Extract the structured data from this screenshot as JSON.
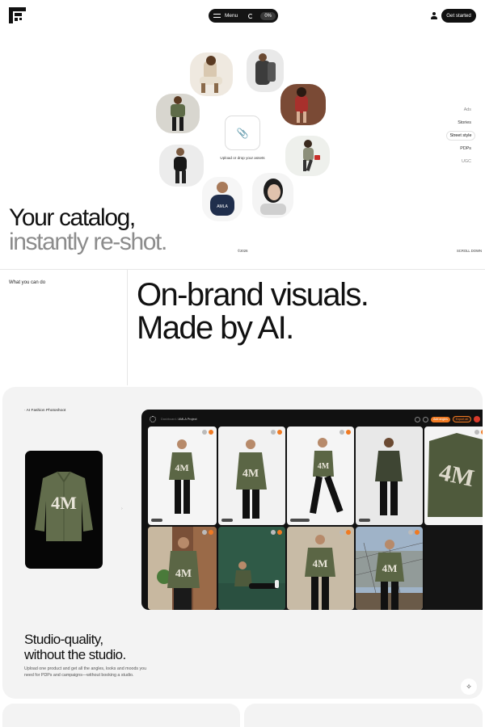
{
  "header": {
    "menu_label": "Menu",
    "progress_label": "0%",
    "get_started_label": "Get started"
  },
  "upload": {
    "label": "Upload or drop your assets"
  },
  "side_menu": [
    {
      "label": "Ads",
      "active": false
    },
    {
      "label": "Stories",
      "active": false
    },
    {
      "label": "Street style",
      "active": true
    },
    {
      "label": "PDPs",
      "active": false
    },
    {
      "label": "UGC",
      "active": false
    }
  ],
  "hero": {
    "title_line1": "Your catalog,",
    "title_line2": "instantly re-shot.",
    "copyright": "©2026",
    "scroll_hint": "SCROLL DOWN"
  },
  "section": {
    "label": "What you can do",
    "title_line1": "On-brand visuals.",
    "title_line2": "Made by AI."
  },
  "feature": {
    "tag": "AI Fashion Photoshoot",
    "jacket_print": "4M",
    "app": {
      "breadcrumb_root": "Dashboard",
      "breadcrumb_project": "AMLA Project",
      "add_angles": "Add angles",
      "export": "Export all"
    },
    "title_line1": "Studio-quality,",
    "title_line2": "without the studio.",
    "description": "Upload one product and get all the angles, looks and moods you need for PDPs and campaigns—without booking a studio."
  },
  "colors": {
    "accent": "#f07a22",
    "jacket": "#626d4c",
    "dark": "#111111"
  },
  "icons": {
    "logo": "brand-logo",
    "menu": "hamburger-icon",
    "theme": "moon-icon",
    "user": "user-icon",
    "upload": "paperclip-icon",
    "sparkle": "sparkle-icon"
  }
}
